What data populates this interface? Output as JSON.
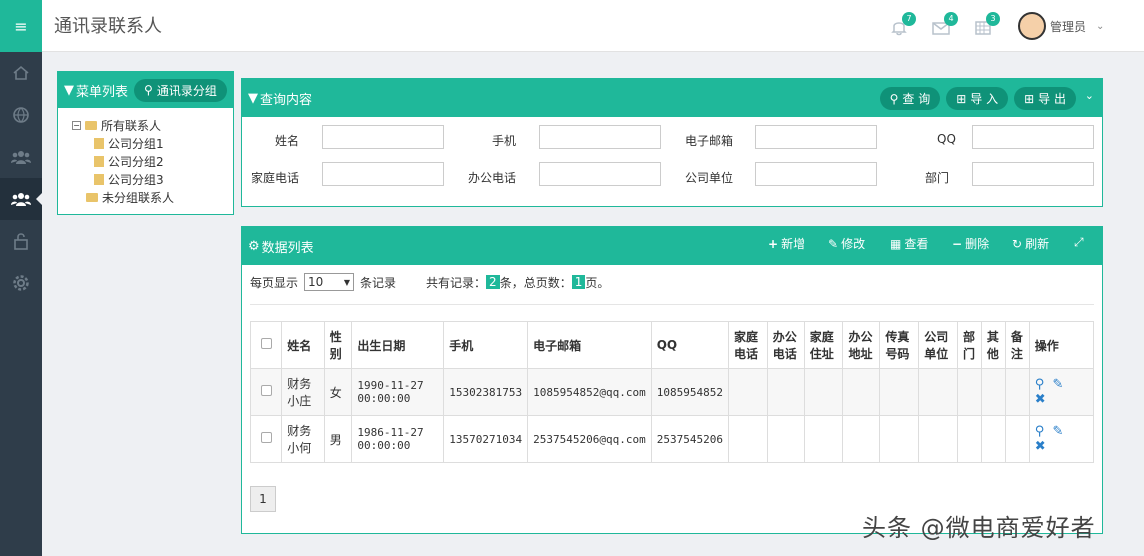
{
  "header": {
    "title": "通讯录联系人",
    "badges": {
      "bell": "7",
      "mail": "4",
      "calendar": "3"
    },
    "username": "管理员"
  },
  "menu_panel": {
    "title": "菜单列表",
    "group_button": "通讯录分组",
    "tree": {
      "root": "所有联系人",
      "children": [
        "公司分组1",
        "公司分组2",
        "公司分组3"
      ],
      "ungrouped": "未分组联系人"
    }
  },
  "query_panel": {
    "title": "查询内容",
    "search_button": "查 询",
    "import_button": "导 入",
    "export_button": "导 出",
    "fields": [
      {
        "label": "姓名"
      },
      {
        "label": "手机"
      },
      {
        "label": "电子邮箱"
      },
      {
        "label": "QQ"
      },
      {
        "label": "家庭电话"
      },
      {
        "label": "办公电话"
      },
      {
        "label": "公司单位"
      },
      {
        "label": "部门"
      }
    ]
  },
  "data_panel": {
    "title": "数据列表",
    "actions": {
      "add": "新增",
      "edit": "修改",
      "view": "查看",
      "delete": "删除",
      "refresh": "刷新"
    },
    "per_page_label": "每页显示",
    "per_page_value": "10",
    "records_label": "条记录",
    "total_prefix": "共有记录：",
    "total_records": "2",
    "total_mid": "条，总页数：",
    "total_pages": "1",
    "total_suffix": "页。",
    "columns": [
      "姓名",
      "性别",
      "出生日期",
      "手机",
      "电子邮箱",
      "QQ",
      "家庭电话",
      "办公电话",
      "家庭住址",
      "办公地址",
      "传真号码",
      "公司单位",
      "部门",
      "其他",
      "备注",
      "操作"
    ],
    "rows": [
      {
        "name": "财务小庄",
        "gender": "女",
        "birth": "1990-11-27 00:00:00",
        "phone": "15302381753",
        "email": "1085954852@qq.com",
        "qq": "1085954852"
      },
      {
        "name": "财务小何",
        "gender": "男",
        "birth": "1986-11-27 00:00:00",
        "phone": "13570271034",
        "email": "2537545206@qq.com",
        "qq": "2537545206"
      }
    ],
    "page_number": "1"
  },
  "watermark": "头条 @微电商爱好者",
  "colors": {
    "accent": "#1fb89a",
    "rail": "#2f3d4a",
    "pill": "#0f9278"
  }
}
